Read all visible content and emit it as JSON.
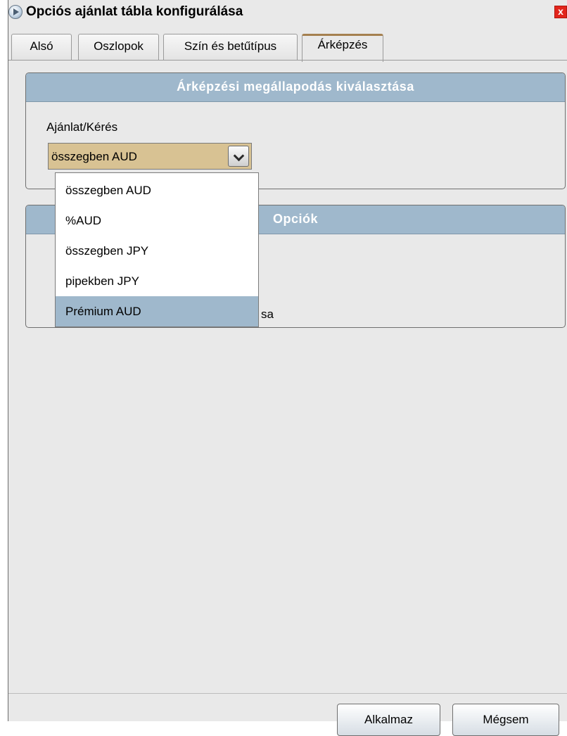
{
  "window": {
    "title": "Opciós ajánlat tábla konfigurálása",
    "close_label": "x"
  },
  "tabs": [
    {
      "label": "Alsó"
    },
    {
      "label": "Oszlopok"
    },
    {
      "label": "Szín és betűtípus"
    },
    {
      "label": "Árképzés",
      "active": true
    }
  ],
  "pricing_section": {
    "title": "Árképzési megállapodás kiválasztása",
    "field_label": "Ajánlat/Kérés",
    "selected_value": "összegben AUD",
    "options": [
      {
        "label": "összegben AUD"
      },
      {
        "label": "%AUD"
      },
      {
        "label": "összegben JPY"
      },
      {
        "label": "pipekben JPY"
      },
      {
        "label": "Prémium AUD",
        "highlighted": true
      }
    ]
  },
  "options_section": {
    "title": "Opciók",
    "partial_text": "sa"
  },
  "footer": {
    "apply_label": "Alkalmaz",
    "cancel_label": "Mégsem"
  },
  "colors": {
    "section_header": "#9fb8cc",
    "combo_background": "#d8c293",
    "active_tab_accent": "#a5804f",
    "close_button": "#e2241b"
  }
}
